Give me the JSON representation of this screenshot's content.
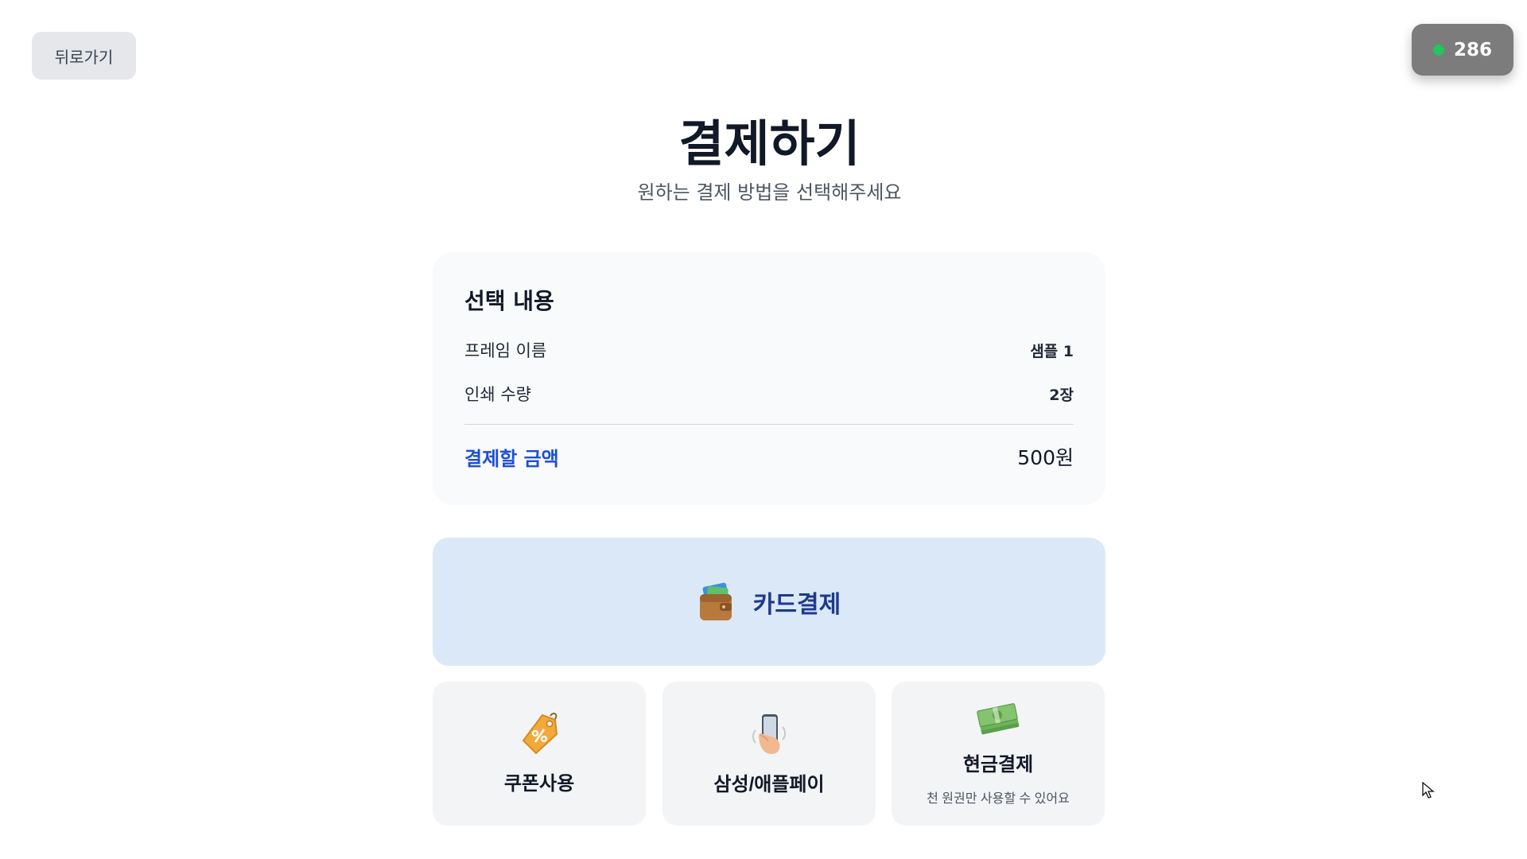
{
  "back_button": {
    "label": "뒤로가기"
  },
  "timer": {
    "value": "286",
    "status_color": "#22c55e"
  },
  "header": {
    "title": "결제하기",
    "subtitle": "원하는 결제 방법을 선택해주세요"
  },
  "summary": {
    "heading": "선택 내용",
    "rows": [
      {
        "label": "프레임 이름",
        "value": "샘플 1"
      },
      {
        "label": "인쇄 수량",
        "value": "2장"
      }
    ],
    "total_label": "결제할 금액",
    "total_value": "500원"
  },
  "payment": {
    "card": {
      "label": "카드결제",
      "icon": "wallet-icon"
    },
    "options": [
      {
        "label": "쿠폰사용",
        "icon": "coupon-tag-icon"
      },
      {
        "label": "삼성/애플페이",
        "icon": "mobile-phone-icon"
      },
      {
        "label": "현금결제",
        "icon": "cash-icon",
        "note": "천 원권만 사용할 수 있어요"
      }
    ]
  },
  "colors": {
    "accent": "#1d4ed8",
    "card_bg": "#dbe8f8",
    "option_bg": "#f3f4f6"
  }
}
